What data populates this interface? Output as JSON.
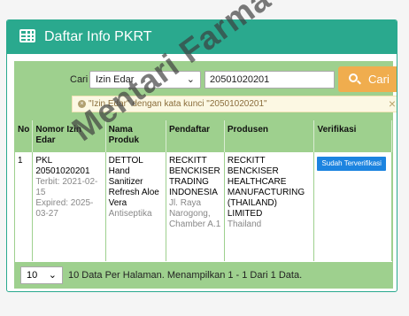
{
  "panel": {
    "title": "Daftar Info PKRT",
    "icon": "table-icon"
  },
  "search": {
    "label": "Cari",
    "select_value": "Izin Edar",
    "keyword": "20501020201",
    "button_label": "Cari"
  },
  "alert": {
    "text": "\"Izin Edar\" dengan kata kunci \"20501020201\"",
    "close": "×"
  },
  "table": {
    "headers": [
      "No",
      "Nomor Izin Edar",
      "Nama Produk",
      "Pendaftar",
      "Produsen",
      "Verifikasi"
    ],
    "rows": [
      {
        "no": "1",
        "izin": "PKL 20501020201",
        "terbit": "Terbit: 2021-02-15",
        "expired": "Expired: 2025-03-27",
        "produk": "DETTOL Hand Sanitizer Refresh Aloe Vera",
        "produk_sub": "Antiseptika",
        "pendaftar": "RECKITT BENCKISER TRADING INDONESIA",
        "pendaftar_alamat": "Jl. Raya Narogong, Chamber A.1",
        "produsen": "RECKITT BENCKISER HEALTHCARE MANUFACTURING (THAILAND) LIMITED",
        "produsen_negara": "Thailand",
        "verifikasi": "Sudah Terverifikasi"
      }
    ]
  },
  "footer": {
    "per_page": "10",
    "text": "10 Data Per Halaman. Menampilkan 1 - 1 Dari 1 Data."
  },
  "watermark": "Mentari Farma",
  "colors": {
    "header": "#2aa98e",
    "bar": "#9ed08e",
    "button": "#f0ad4e",
    "badge": "#1c84e0"
  }
}
